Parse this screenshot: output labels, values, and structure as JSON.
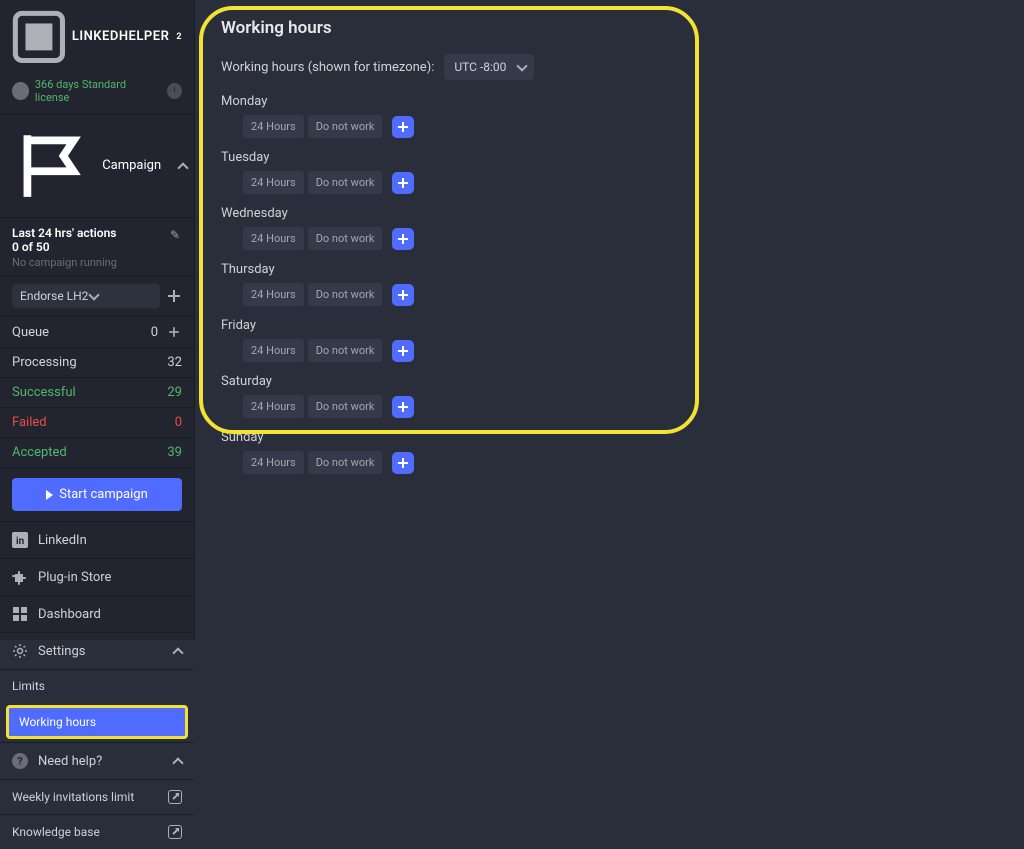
{
  "brand": {
    "name": "LINKEDHELPER",
    "sup": "2"
  },
  "license": {
    "label": "366 days Standard license"
  },
  "campaign": {
    "header": "Campaign",
    "actions_title": "Last 24 hrs' actions",
    "actions_count": "0 of 50",
    "actions_sub": "No campaign running",
    "endorse_label": "Endorse LH2"
  },
  "stats": {
    "queue": {
      "label": "Queue",
      "value": "0"
    },
    "processing": {
      "label": "Processing",
      "value": "32"
    },
    "successful": {
      "label": "Successful",
      "value": "29"
    },
    "failed": {
      "label": "Failed",
      "value": "0"
    },
    "accepted": {
      "label": "Accepted",
      "value": "39"
    }
  },
  "start_label": "Start campaign",
  "nav": {
    "linkedin": "LinkedIn",
    "plugin": "Plug-in Store",
    "dashboard": "Dashboard",
    "settings": "Settings",
    "limits": "Limits",
    "working_hours": "Working hours",
    "need_help": "Need help?",
    "weekly": "Weekly invitations limit",
    "kb": "Knowledge base"
  },
  "main": {
    "title": "Working hours",
    "tz_label": "Working hours (shown for timezone):",
    "tz_value": "UTC -8:00",
    "opt_24h": "24 Hours",
    "opt_dnw": "Do not work",
    "days": {
      "mon": "Monday",
      "tue": "Tuesday",
      "wed": "Wednesday",
      "thu": "Thursday",
      "fri": "Friday",
      "sat": "Saturday",
      "sun": "Sunday"
    }
  }
}
